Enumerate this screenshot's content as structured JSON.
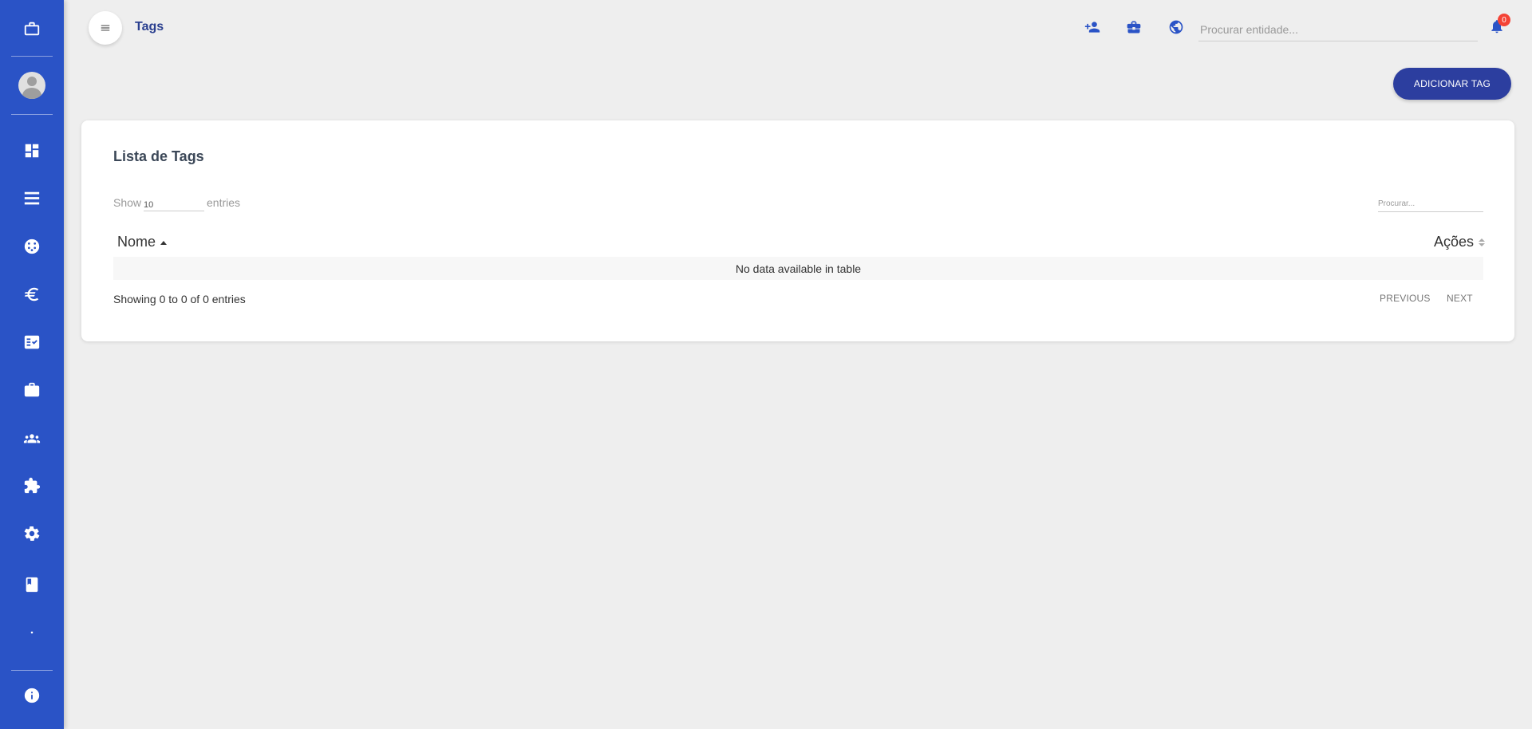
{
  "header": {
    "title": "Tags",
    "entity_search_placeholder": "Procurar entidade...",
    "notifications_count": "0"
  },
  "actions": {
    "add_tag_label": "ADICIONAR TAG"
  },
  "card": {
    "title": "Lista de Tags",
    "show_label": "Show",
    "page_size": "10",
    "entries_label": "entries",
    "search_placeholder": "Procurar...",
    "columns": [
      "Nome",
      "Ações"
    ],
    "empty_message": "No data available in table",
    "info": "Showing 0 to 0 of 0 entries",
    "previous_label": "PREVIOUS",
    "next_label": "NEXT"
  },
  "sidebar": {
    "items": [
      {
        "icon": "briefcase-icon"
      },
      {
        "icon": "dashboard-icon"
      },
      {
        "icon": "list-icon"
      },
      {
        "icon": "palette-icon"
      },
      {
        "icon": "euro-icon"
      },
      {
        "icon": "checklist-icon"
      },
      {
        "icon": "work-icon"
      },
      {
        "icon": "group-icon"
      },
      {
        "icon": "puzzle-icon"
      },
      {
        "icon": "settings-icon"
      },
      {
        "icon": "book-icon"
      },
      {
        "icon": "dot-icon"
      },
      {
        "icon": "info-icon"
      }
    ]
  },
  "colors": {
    "sidebar": "#2a53c6",
    "primary_button": "#2c3e9f",
    "title": "#2a3f8f",
    "badge": "#f44336"
  }
}
